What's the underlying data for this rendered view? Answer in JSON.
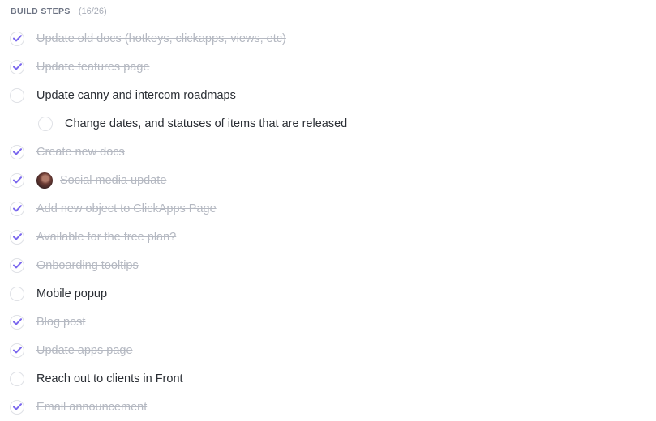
{
  "section": {
    "title": "BUILD STEPS",
    "count": "(16/26)"
  },
  "colors": {
    "accent": "#7b68ee",
    "done_text": "#b5b9c2",
    "open_text": "#2a2e34",
    "circle_border": "#dfe1e6"
  },
  "icons": {
    "checked": "checkmark-icon",
    "unchecked": "empty-circle-icon",
    "assignee": "avatar"
  },
  "items": [
    {
      "label": "Update old docs (hotkeys, clickapps, views, etc)",
      "done": true,
      "sub": false,
      "avatar": false
    },
    {
      "label": "Update features page",
      "done": true,
      "sub": false,
      "avatar": false
    },
    {
      "label": "Update canny and intercom roadmaps",
      "done": false,
      "sub": false,
      "avatar": false
    },
    {
      "label": "Change dates, and statuses of items that are released",
      "done": false,
      "sub": true,
      "avatar": false
    },
    {
      "label": "Create new docs",
      "done": true,
      "sub": false,
      "avatar": false
    },
    {
      "label": "Social media update",
      "done": true,
      "sub": false,
      "avatar": true
    },
    {
      "label": "Add new object to ClickApps Page",
      "done": true,
      "sub": false,
      "avatar": false
    },
    {
      "label": "Available for the free plan?",
      "done": true,
      "sub": false,
      "avatar": false
    },
    {
      "label": "Onboarding tooltips",
      "done": true,
      "sub": false,
      "avatar": false
    },
    {
      "label": "Mobile popup",
      "done": false,
      "sub": false,
      "avatar": false
    },
    {
      "label": "Blog post",
      "done": true,
      "sub": false,
      "avatar": false
    },
    {
      "label": "Update apps page",
      "done": true,
      "sub": false,
      "avatar": false
    },
    {
      "label": "Reach out to clients in Front",
      "done": false,
      "sub": false,
      "avatar": false
    },
    {
      "label": "Email announcement",
      "done": true,
      "sub": false,
      "avatar": false
    }
  ]
}
